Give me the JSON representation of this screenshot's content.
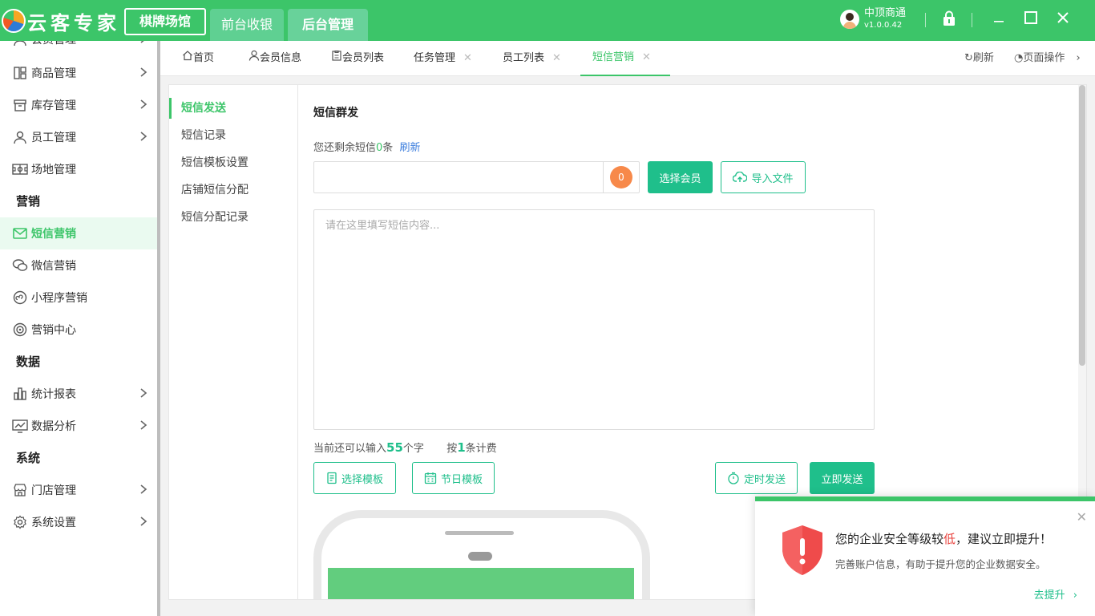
{
  "app": {
    "logo_text": "云客专家",
    "venue_button": "棋牌场馆",
    "top_tabs": [
      "前台收银",
      "后台管理"
    ],
    "user_name": "中顶商通",
    "version": "v1.0.0.42"
  },
  "sidebar": {
    "partial_item": "会员管理",
    "items_top": [
      {
        "label": "商品管理",
        "icon": "grid-icon"
      },
      {
        "label": "库存管理",
        "icon": "box-icon"
      },
      {
        "label": "员工管理",
        "icon": "person-icon"
      },
      {
        "label": "场地管理",
        "icon": "venue-icon"
      }
    ],
    "group_marketing": "营销",
    "marketing_items": [
      {
        "label": "短信营销",
        "icon": "mail-icon"
      },
      {
        "label": "微信营销",
        "icon": "wechat-icon"
      },
      {
        "label": "小程序营销",
        "icon": "miniprogram-icon"
      },
      {
        "label": "营销中心",
        "icon": "target-icon"
      }
    ],
    "group_data": "数据",
    "data_items": [
      {
        "label": "统计报表",
        "icon": "bar-chart-icon"
      },
      {
        "label": "数据分析",
        "icon": "line-chart-icon"
      }
    ],
    "group_system": "系统",
    "system_items": [
      {
        "label": "门店管理",
        "icon": "store-icon"
      },
      {
        "label": "系统设置",
        "icon": "gear-icon"
      }
    ]
  },
  "tabs": {
    "home": "首页",
    "member_info": "会员信息",
    "member_list": "会员列表",
    "task_mgmt": "任务管理",
    "staff_list": "员工列表",
    "sms_marketing": "短信营销",
    "refresh": "刷新",
    "page_ops": "页面操作"
  },
  "submenu": [
    "短信发送",
    "短信记录",
    "短信模板设置",
    "店铺短信分配",
    "短信分配记录"
  ],
  "sms": {
    "title": "短信群发",
    "remain_prefix": "您还剩余短信",
    "remain_count": "0",
    "remain_suffix": "条",
    "refresh": "刷新",
    "recipient_count": "0",
    "select_member": "选择会员",
    "import_file": "导入文件",
    "content_placeholder": "请在这里填写短信内容...",
    "input_prefix": "当前还可以输入",
    "input_remaining": "55",
    "input_suffix": "个字",
    "billing_prefix": "按",
    "billing_count": "1",
    "billing_suffix": "条计费",
    "select_template": "选择模板",
    "holiday_template": "节日模板",
    "scheduled_send": "定时发送",
    "send_now": "立即发送"
  },
  "toast": {
    "headline_prefix": "您的企业安全等级较",
    "headline_low": "低",
    "headline_suffix": "，建议立即提升！",
    "desc": "完善账户信息，有助于提升您的企业数据安全。",
    "upgrade": "去提升"
  },
  "colors": {
    "brand_green": "#3cc569",
    "button_green": "#1fbf8b",
    "badge_orange": "#f7894a",
    "danger_red": "#e8413c"
  }
}
